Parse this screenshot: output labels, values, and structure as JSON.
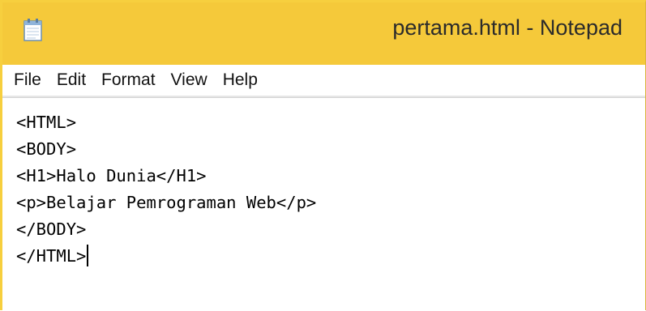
{
  "window": {
    "title": "pertama.html - Notepad",
    "app_icon": "notepad-icon",
    "titlebar_color": "#f5c93a"
  },
  "menu": {
    "items": [
      "File",
      "Edit",
      "Format",
      "View",
      "Help"
    ]
  },
  "editor": {
    "lines": [
      "<HTML>",
      "<BODY>",
      "<H1>Halo Dunia</H1>",
      "<p>Belajar Pemrograman Web</p>",
      "</BODY>",
      "</HTML>"
    ],
    "caret_after_last_line": true
  }
}
